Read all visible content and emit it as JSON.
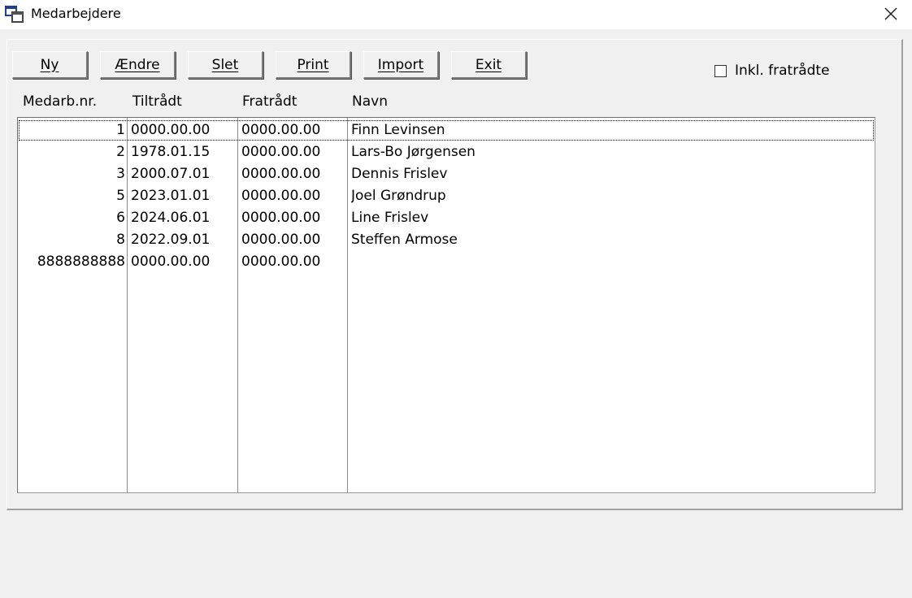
{
  "window": {
    "title": "Medarbejdere",
    "icon": "app-windows-icon",
    "close_icon": "close-icon"
  },
  "toolbar": {
    "buttons": [
      {
        "label": "Ny",
        "name": "ny-button"
      },
      {
        "label": "Ændre",
        "name": "aendre-button"
      },
      {
        "label": "Slet",
        "name": "slet-button"
      },
      {
        "label": "Print",
        "name": "print-button"
      },
      {
        "label": "Import",
        "name": "import-button"
      },
      {
        "label": "Exit",
        "name": "exit-button"
      }
    ],
    "include_resigned": {
      "label": "Inkl. fratrådte",
      "checked": false
    }
  },
  "table": {
    "headers": [
      "Medarb.nr.",
      "Tiltrådt",
      "Fratrådt",
      "Navn"
    ],
    "rows": [
      {
        "nr": "1",
        "tiltraadt": "0000.00.00",
        "fratraadt": "0000.00.00",
        "navn": "Finn Levinsen",
        "selected": true
      },
      {
        "nr": "2",
        "tiltraadt": "1978.01.15",
        "fratraadt": "0000.00.00",
        "navn": "Lars-Bo Jørgensen",
        "selected": false
      },
      {
        "nr": "3",
        "tiltraadt": "2000.07.01",
        "fratraadt": "0000.00.00",
        "navn": "Dennis Frislev",
        "selected": false
      },
      {
        "nr": "5",
        "tiltraadt": "2023.01.01",
        "fratraadt": "0000.00.00",
        "navn": "Joel Grøndrup",
        "selected": false
      },
      {
        "nr": "6",
        "tiltraadt": "2024.06.01",
        "fratraadt": "0000.00.00",
        "navn": "Line Frislev",
        "selected": false
      },
      {
        "nr": "8",
        "tiltraadt": "2022.09.01",
        "fratraadt": "0000.00.00",
        "navn": "Steffen Armose",
        "selected": false
      },
      {
        "nr": "8888888888",
        "tiltraadt": "0000.00.00",
        "fratraadt": "0000.00.00",
        "navn": "",
        "selected": false
      }
    ]
  }
}
